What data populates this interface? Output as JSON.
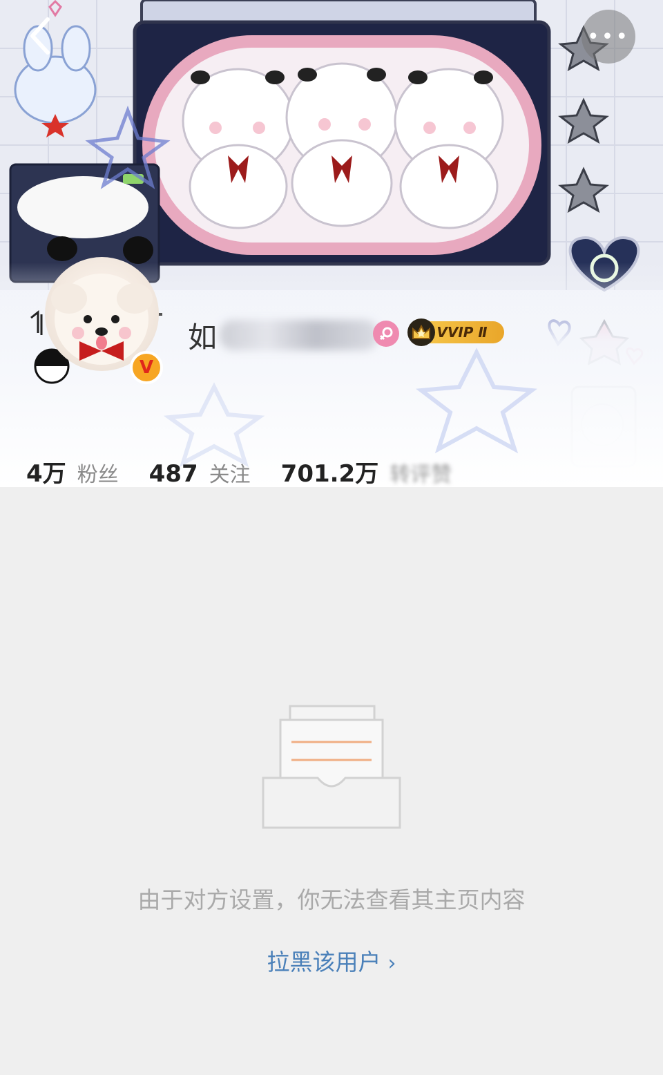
{
  "header": {
    "back_icon": "chevron-left-icon",
    "more_icon": "more-horizontal-icon",
    "more_label": "•••"
  },
  "profile": {
    "name_visible": "如",
    "name_obscured": true,
    "gender": "female",
    "gender_color": "#ef8ab0",
    "verified_badge": "V",
    "verified_color": "#f7a623",
    "vip_label": "VVIP Ⅱ"
  },
  "stats": [
    {
      "value": "4万",
      "label": "粉丝"
    },
    {
      "value": "487",
      "label": "关注"
    },
    {
      "value": "701.2万",
      "label": "转评赞"
    }
  ],
  "empty_state": {
    "icon": "empty-inbox-icon",
    "message": "由于对方设置，你无法查看其主页内容",
    "action_label": "拉黑该用户",
    "action_chevron": "›",
    "action_color": "#4a80b9"
  }
}
